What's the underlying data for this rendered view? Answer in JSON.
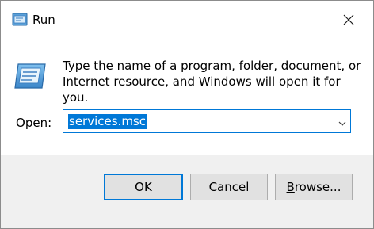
{
  "window": {
    "title": "Run"
  },
  "icons": {
    "title": "run-icon",
    "close": "close-icon",
    "app": "run-icon",
    "dropdown": "chevron-down-icon"
  },
  "message": {
    "line1": "Type the name of a program, folder, document, or",
    "line2": "Internet resource, and Windows will open it for you."
  },
  "open_field": {
    "label_prefix": "O",
    "label_rest": "pen:",
    "value": "services.msc"
  },
  "buttons": {
    "ok": "OK",
    "cancel": "Cancel",
    "browse_prefix": "B",
    "browse_rest": "rowse..."
  },
  "colors": {
    "accent": "#0078d7",
    "footer_bg": "#f0f0f0",
    "button_bg": "#e1e1e1"
  }
}
